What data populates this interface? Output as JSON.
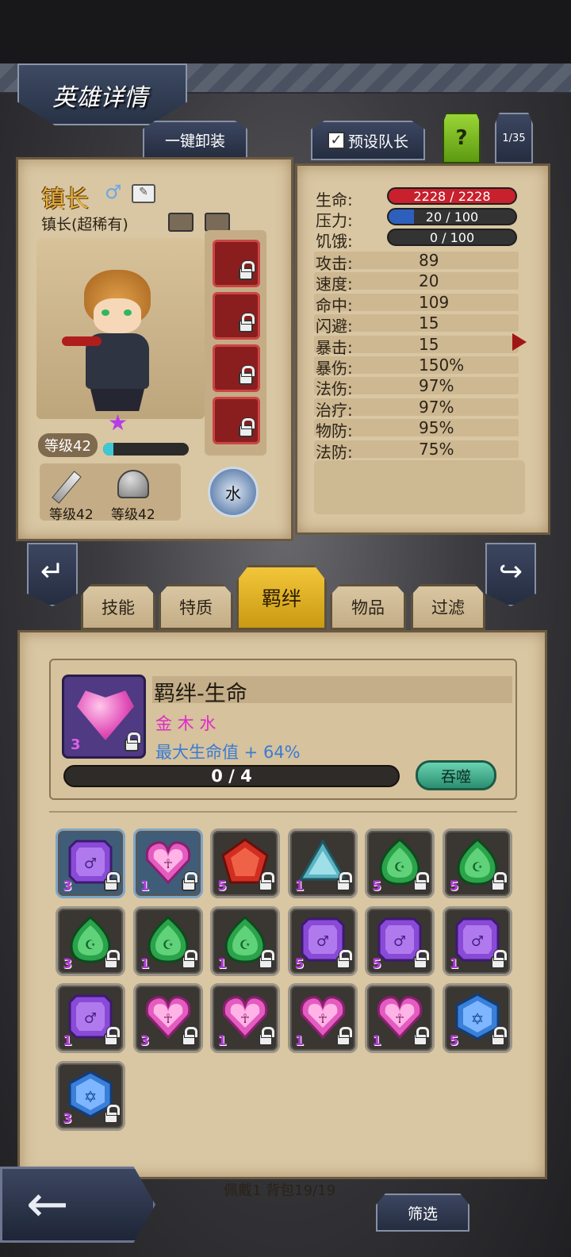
{
  "header": {
    "title": "英雄详情",
    "unequip_all": "一键卸装",
    "preset_leader": "预设队长",
    "help": "?",
    "page_counter": "1/35"
  },
  "hero": {
    "name": "镇长",
    "rarity": "镇长(超稀有)",
    "gender_icon": "male-icon",
    "level": "等级42",
    "exp_fraction": 0.12,
    "weapon_level": "等级42",
    "armor_level": "等级42",
    "element": "水",
    "stars": 1
  },
  "stats": {
    "hp_label": "生命:",
    "hp": "2228 / 2228",
    "hp_fraction": 1.0,
    "stress_label": "压力:",
    "stress": "20 / 100",
    "stress_fraction": 0.2,
    "hunger_label": "饥饿:",
    "hunger": "0 / 100",
    "hunger_fraction": 0.0,
    "rows": [
      {
        "label": "攻击:",
        "value": "89"
      },
      {
        "label": "速度:",
        "value": "20"
      },
      {
        "label": "命中:",
        "value": "109"
      },
      {
        "label": "闪避:",
        "value": "15"
      },
      {
        "label": "暴击:",
        "value": "15"
      },
      {
        "label": "暴伤:",
        "value": "150%"
      },
      {
        "label": "法伤:",
        "value": "97%"
      },
      {
        "label": "治疗:",
        "value": "97%"
      },
      {
        "label": "物防:",
        "value": "95%"
      },
      {
        "label": "法防:",
        "value": "75%"
      }
    ]
  },
  "tabs": [
    {
      "label": "技能"
    },
    {
      "label": "特质"
    },
    {
      "label": "羁绊"
    },
    {
      "label": "物品"
    },
    {
      "label": "过滤"
    }
  ],
  "bond": {
    "title": "羁绊-生命",
    "elements": "金 木 水",
    "effect": "最大生命值 + 64%",
    "count": "3",
    "progress": "0 / 4",
    "progress_fraction": 0.0,
    "devour": "吞噬"
  },
  "gems": [
    {
      "type": "purple-square",
      "count": "3",
      "selected": true
    },
    {
      "type": "pink-heart",
      "count": "1",
      "selected": true
    },
    {
      "type": "red-pentagon",
      "count": "5",
      "selected": false
    },
    {
      "type": "teal-triangle",
      "count": "1",
      "selected": false
    },
    {
      "type": "green-drop",
      "count": "5",
      "selected": false
    },
    {
      "type": "green-drop",
      "count": "5",
      "selected": false
    },
    {
      "type": "green-drop",
      "count": "3",
      "selected": false
    },
    {
      "type": "green-drop",
      "count": "1",
      "selected": false
    },
    {
      "type": "green-drop",
      "count": "1",
      "selected": false
    },
    {
      "type": "purple-square",
      "count": "5",
      "selected": false
    },
    {
      "type": "purple-square",
      "count": "5",
      "selected": false
    },
    {
      "type": "purple-square",
      "count": "1",
      "selected": false
    },
    {
      "type": "purple-square",
      "count": "1",
      "selected": false
    },
    {
      "type": "pink-heart",
      "count": "3",
      "selected": false
    },
    {
      "type": "pink-heart",
      "count": "1",
      "selected": false
    },
    {
      "type": "pink-heart",
      "count": "1",
      "selected": false
    },
    {
      "type": "pink-heart",
      "count": "1",
      "selected": false
    },
    {
      "type": "blue-hexagon",
      "count": "5",
      "selected": false
    },
    {
      "type": "blue-hexagon",
      "count": "3",
      "selected": false
    }
  ],
  "footer": {
    "inventory": "佩戴1 背包19/19",
    "filter": "筛选"
  },
  "colors": {
    "hp": "#c8202c",
    "stress": "#2e5fbd",
    "tab_active": "#e8b826",
    "bond_pink": "#e02acb",
    "bond_blue": "#3a7bd5"
  }
}
